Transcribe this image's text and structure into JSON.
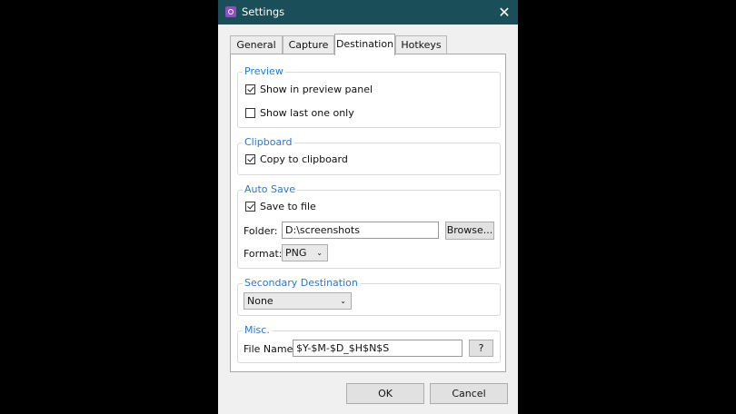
{
  "window": {
    "title": "Settings",
    "close_glyph": "✕"
  },
  "tabs": [
    {
      "label": "General"
    },
    {
      "label": "Capture"
    },
    {
      "label": "Destination",
      "active": true
    },
    {
      "label": "Hotkeys"
    }
  ],
  "preview": {
    "title": "Preview",
    "show_in_preview_panel": {
      "label": "Show in preview panel",
      "checked": true
    },
    "show_last_one_only": {
      "label": "Show last one only",
      "checked": false
    }
  },
  "clipboard": {
    "title": "Clipboard",
    "copy_to_clipboard": {
      "label": "Copy to clipboard",
      "checked": true
    }
  },
  "auto_save": {
    "title": "Auto Save",
    "save_to_file": {
      "label": "Save to file",
      "checked": true
    },
    "folder_label": "Folder:",
    "folder_value": "D:\\screenshots",
    "browse_label": "Browse...",
    "format_label": "Format:",
    "format_value": "PNG"
  },
  "secondary_destination": {
    "title": "Secondary Destination",
    "value": "None"
  },
  "misc": {
    "title": "Misc.",
    "file_name_label": "File Name:",
    "file_name_value": "$Y-$M-$D_$H$N$S",
    "help_label": "?"
  },
  "footer": {
    "ok_label": "OK",
    "cancel_label": "Cancel"
  },
  "icons": {
    "app": "app-icon",
    "close": "close-icon",
    "dropdown": "chevron-down-icon"
  },
  "colors": {
    "titlebar": "#1a4e58",
    "group_title": "#2b78c8",
    "window_bg": "#f0f0f0"
  }
}
